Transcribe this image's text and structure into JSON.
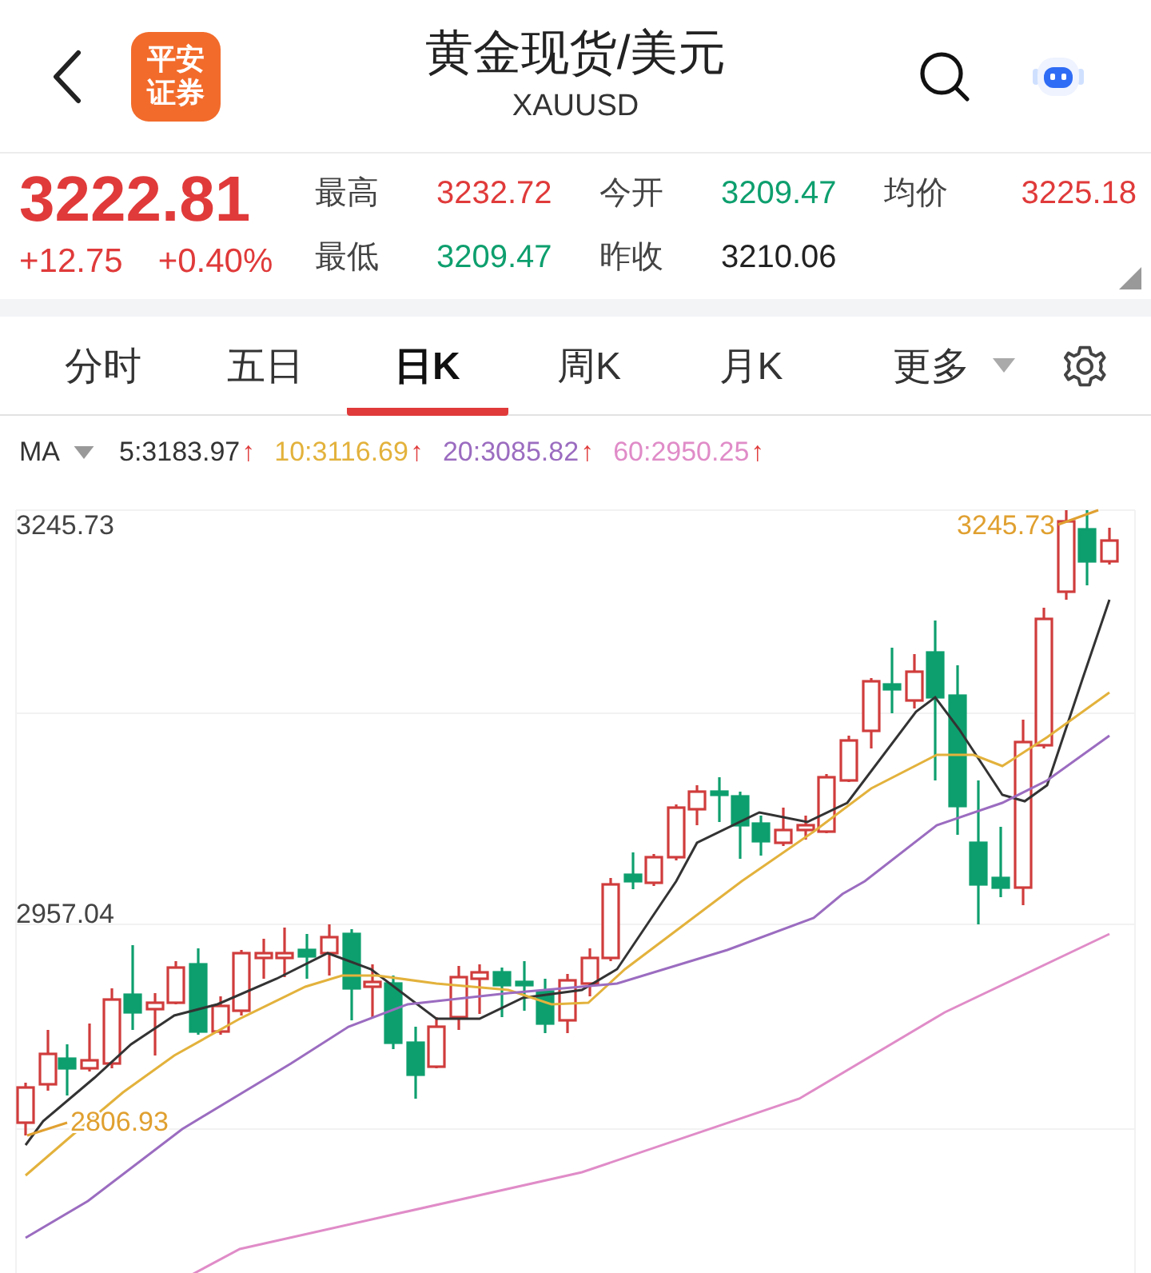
{
  "header": {
    "title": "黄金现货/美元",
    "subtitle": "XAUUSD",
    "logo_lines": [
      "平安",
      "证券"
    ]
  },
  "quote": {
    "price": "3222.81",
    "change": "+12.75",
    "change_pct": "+0.40%",
    "color": "#e03a3a",
    "stats": [
      {
        "label": "最高",
        "value": "3232.72",
        "color": "#e03a3a"
      },
      {
        "label": "今开",
        "value": "3209.47",
        "color": "#0e9f6e"
      },
      {
        "label": "均价",
        "value": "3225.18",
        "color": "#e03a3a"
      },
      {
        "label": "最低",
        "value": "3209.47",
        "color": "#0e9f6e"
      },
      {
        "label": "昨收",
        "value": "3210.06",
        "color": "#222222"
      }
    ]
  },
  "tabs": [
    {
      "label": "分时",
      "selected": false,
      "kind": "plain"
    },
    {
      "label": "五日",
      "selected": false,
      "kind": "plain"
    },
    {
      "label": "日K",
      "selected": true,
      "kind": "plain"
    },
    {
      "label": "周K",
      "selected": false,
      "kind": "plain"
    },
    {
      "label": "月K",
      "selected": false,
      "kind": "plain"
    },
    {
      "label": "更多",
      "selected": false,
      "kind": "dropdown"
    }
  ],
  "indicator": {
    "label": "MA",
    "averages": [
      {
        "text": "5:3183.97",
        "arrow": "↑",
        "color": "#333333"
      },
      {
        "text": "10:3116.69",
        "arrow": "↑",
        "color": "#e3b23c"
      },
      {
        "text": "20:3085.82",
        "arrow": "↑",
        "color": "#9b6cc0"
      },
      {
        "text": "60:2950.25",
        "arrow": "↑",
        "color": "#e08cc8"
      }
    ]
  },
  "chart": {
    "axis_labels": [
      "3245.73",
      "2957.04"
    ],
    "high_label": "3245.73",
    "low_label": "2806.93"
  }
}
